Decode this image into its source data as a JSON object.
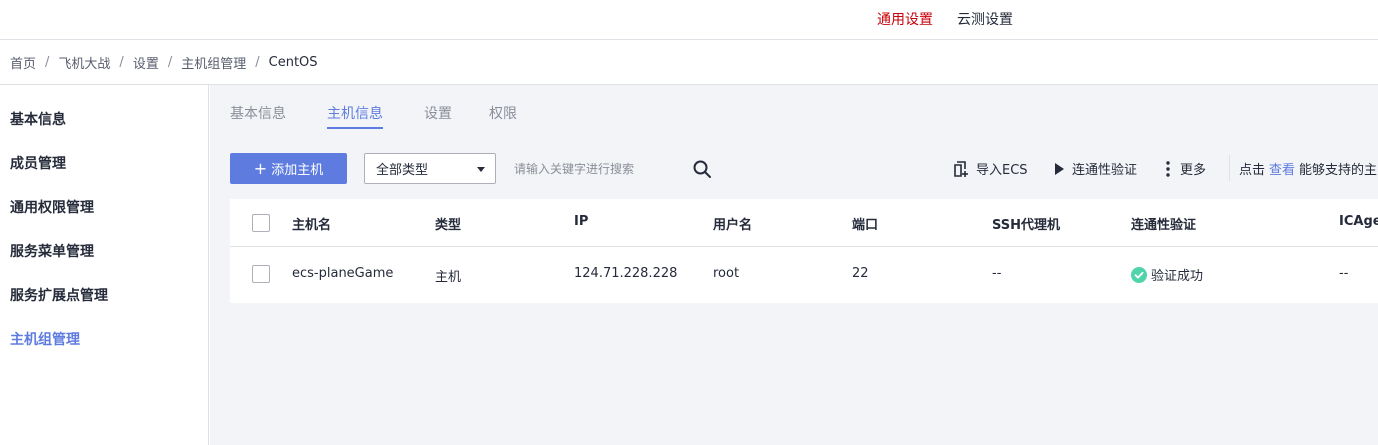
{
  "topbar": {
    "general_settings": "通用设置",
    "cloud_test_settings": "云测设置"
  },
  "breadcrumb": {
    "items": [
      "首页",
      "飞机大战",
      "设置",
      "主机组管理",
      "CentOS"
    ],
    "separator": "/"
  },
  "sidebar": {
    "items": [
      {
        "label": "基本信息"
      },
      {
        "label": "成员管理"
      },
      {
        "label": "通用权限管理"
      },
      {
        "label": "服务菜单管理"
      },
      {
        "label": "服务扩展点管理"
      },
      {
        "label": "主机组管理"
      }
    ],
    "active_index": 5
  },
  "tabs": {
    "items": [
      "基本信息",
      "主机信息",
      "设置",
      "权限"
    ],
    "active_index": 1
  },
  "toolbar": {
    "add_host_label": "添加主机",
    "type_select_value": "全部类型",
    "search_placeholder": "请输入关键字进行搜索",
    "import_ecs_label": "导入ECS",
    "connectivity_label": "连通性验证",
    "more_label": "更多",
    "hint_prefix": "点击",
    "hint_link": "查看",
    "hint_suffix": "能够支持的主"
  },
  "table": {
    "columns": [
      "主机名",
      "类型",
      "IP",
      "用户名",
      "端口",
      "SSH代理机",
      "连通性验证",
      "ICAge"
    ],
    "rows": [
      {
        "hostname": "ecs-planeGame",
        "type": "主机",
        "ip": "124.71.228.228",
        "username": "root",
        "port": "22",
        "ssh_proxy": "--",
        "connectivity": "验证成功",
        "icagent": "--"
      }
    ]
  },
  "colors": {
    "primary": "#5e7ce0",
    "active_top_link": "#c7000b",
    "success": "#50d4ab",
    "page_bg": "#f3f4f7"
  },
  "icons": {
    "search": "search-icon",
    "import": "import-icon",
    "play": "play-icon",
    "more": "more-vertical-icon",
    "success": "check-circle-icon"
  }
}
